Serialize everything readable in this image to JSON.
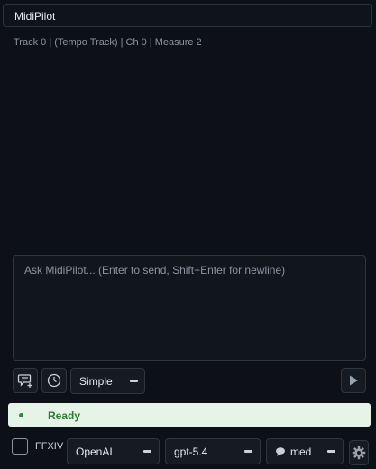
{
  "app": {
    "title": "MidiPilot"
  },
  "context": {
    "text": "Track 0 | (Tempo Track) | Ch 0 | Measure 2"
  },
  "prompt": {
    "placeholder": "Ask MidiPilot... (Enter to send, Shift+Enter for newline)"
  },
  "toolbar": {
    "mode_select": "Simple",
    "icons": [
      "new-chat-icon",
      "history-icon",
      "send-icon"
    ]
  },
  "status": {
    "text": "Ready",
    "color": "#2e7d32",
    "background": "#e6f4e7"
  },
  "footer": {
    "checkbox_label": "FFXIV",
    "checkbox_checked": false,
    "provider": "OpenAI",
    "model": "gpt-5.4",
    "reasoning": "med",
    "icons": [
      "reasoning-icon",
      "settings-icon"
    ]
  },
  "colors": {
    "background": "#0d1117",
    "border": "#30363d",
    "muted_text": "#8b949e"
  }
}
